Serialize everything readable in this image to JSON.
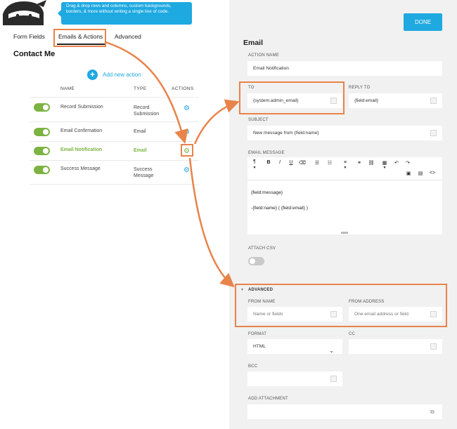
{
  "tooltip": "Drag & drop rows and columns, custom backgrounds, borders, & more without writing a single line of code.",
  "tabs": {
    "form_fields": "Form Fields",
    "emails_actions": "Emails & Actions",
    "advanced": "Advanced"
  },
  "form_title": "Contact Me",
  "add_action": "Add new action",
  "table": {
    "headers": {
      "name": "NAME",
      "type": "TYPE",
      "actions": "ACTIONS"
    },
    "rows": [
      {
        "name": "Record Submission",
        "type": "Record Submission"
      },
      {
        "name": "Email Confirmation",
        "type": "Email"
      },
      {
        "name": "Email Notification",
        "type": "Email"
      },
      {
        "name": "Success Message",
        "type": "Success Message"
      }
    ]
  },
  "panel": {
    "done": "DONE",
    "title": "Email",
    "action_name_label": "ACTION NAME",
    "action_name_value": "Email Notification",
    "to_label": "TO",
    "to_value": "{system:admin_email}",
    "reply_to_label": "REPLY TO",
    "reply_to_value": "{field:email}",
    "subject_label": "SUBJECT",
    "subject_value": "New message from {field:name}",
    "email_message_label": "EMAIL MESSAGE",
    "message_line1": "{field:message}",
    "message_line2": "-{field:name} ( {field:email} )",
    "attach_csv_label": "ATTACH CSV",
    "advanced_label": "ADVANCED",
    "from_name_label": "FROM NAME",
    "from_name_placeholder": "Name or fields",
    "from_address_label": "FROM ADDRESS",
    "from_address_placeholder": "One email address or field",
    "format_label": "FORMAT",
    "format_value": "HTML",
    "cc_label": "CC",
    "bcc_label": "BCC",
    "add_attachment_label": "ADD ATTACHMENT"
  },
  "colors": {
    "accent_blue": "#1ea9e1",
    "active_green": "#7cb342",
    "highlight_orange": "#e8834a"
  }
}
